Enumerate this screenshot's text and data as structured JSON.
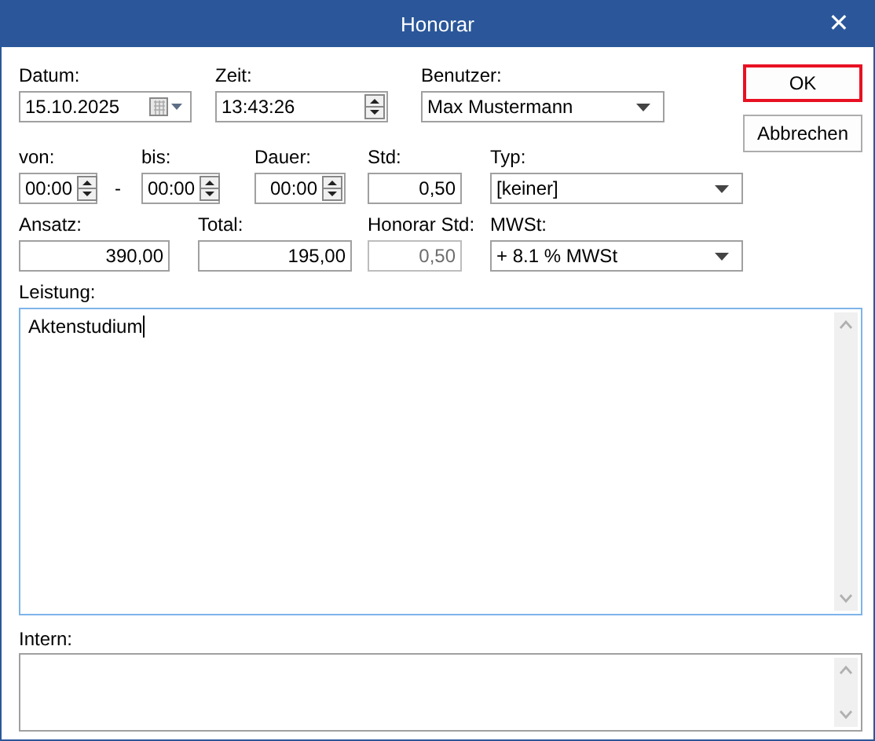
{
  "window": {
    "title": "Honorar",
    "close": "✕"
  },
  "rows": [
    [
      {
        "kind": "date",
        "label": "Datum:",
        "value": "15.10.2025",
        "disabled": false
      },
      {
        "kind": "time",
        "label": "Zeit:",
        "value": "13:43:26",
        "disabled": false
      },
      {
        "kind": "combo",
        "label": "Benutzer:",
        "value": "Max Mustermann",
        "disabled": false
      }
    ],
    [
      {
        "kind": "spin",
        "label": "von:",
        "value": "00:00",
        "disabled": false
      },
      {
        "kind": "separator",
        "label": "-"
      },
      {
        "kind": "spin",
        "label": "bis:",
        "value": "00:00",
        "disabled": false
      },
      {
        "kind": "spin",
        "label": "Dauer:",
        "value": "00:00",
        "disabled": false
      },
      {
        "kind": "number",
        "label": "Std:",
        "value": "0,50",
        "disabled": false
      },
      {
        "kind": "combo",
        "label": "Typ:",
        "value": "[keiner]",
        "disabled": false
      }
    ],
    [
      {
        "kind": "number",
        "label": "Ansatz:",
        "value": "390,00",
        "disabled": false
      },
      {
        "kind": "number",
        "label": "Total:",
        "value": "195,00",
        "disabled": false
      },
      {
        "kind": "number",
        "label": "Honorar Std:",
        "value": "0,50",
        "disabled": true
      },
      {
        "kind": "combo",
        "label": "MWSt:",
        "value": "+ 8.1 % MWSt",
        "disabled": false
      }
    ]
  ],
  "buttons": [
    {
      "label": "OK",
      "focused": true
    },
    {
      "label": "Abbrechen",
      "focused": false
    }
  ],
  "leistung": {
    "label": "Leistung:",
    "value": "Aktenstudium",
    "focused": true
  },
  "intern": {
    "label": "Intern:",
    "focused": false
  }
}
